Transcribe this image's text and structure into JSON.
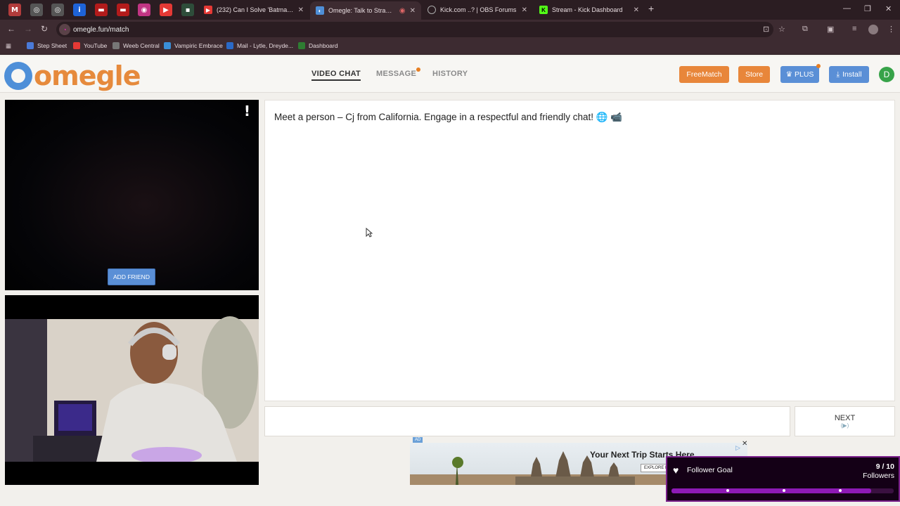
{
  "browser": {
    "tabs": [
      {
        "title": "(232) Can I Solve 'Batman The L",
        "color": "#e53935",
        "icon": "youtube-icon"
      },
      {
        "title": "Omegle: Talk to Strangers w",
        "color": "#4e8fd8",
        "icon": "omegle-icon",
        "active": true
      },
      {
        "title": "Kick.com ..? | OBS Forums",
        "color": "#888888",
        "icon": "obs-icon"
      },
      {
        "title": "Stream - Kick Dashboard",
        "color": "#53fc18",
        "icon": "kick-icon"
      }
    ],
    "url": "omegle.fun/match",
    "bookmarks": [
      {
        "label": "Step Sheet",
        "color": "#4a7ad8"
      },
      {
        "label": "YouTube",
        "color": "#e53935"
      },
      {
        "label": "Weeb Central",
        "color": "#777777"
      },
      {
        "label": "Vampiric Embrace",
        "color": "#3a8fd8"
      },
      {
        "label": "Mail - Lytle, Dreyde...",
        "color": "#2a6ac8"
      },
      {
        "label": "Dashboard",
        "color": "#2e7d32"
      }
    ]
  },
  "site": {
    "logo_text": "omegle",
    "nav": {
      "video_chat": "VIDEO CHAT",
      "message": "MESSAGE",
      "history": "HISTORY"
    },
    "buttons": {
      "freematch": "FreeMatch",
      "store": "Store",
      "plus": "PLUS",
      "install": "Install"
    },
    "avatar_letter": "D"
  },
  "video": {
    "add_friend": "ADD FRIEND",
    "report_mark": "!"
  },
  "chat": {
    "message": "Meet a person – Cj from California. Engage in a respectful and friendly chat! 🌐 📹",
    "next_label": "NEXT"
  },
  "ad": {
    "tag": "AD",
    "title": "Your Next Trip Starts Here",
    "cta": "EXPLORE NOW"
  },
  "follower_goal": {
    "label": "Follower Goal",
    "current": 9,
    "target": 10,
    "count_text": "9 / 10",
    "unit": "Followers",
    "progress_fraction": 0.9
  },
  "colors": {
    "freematch": "#e8863a",
    "store": "#e8863a",
    "plus": "#5a8fd6",
    "install": "#5a8fd6",
    "accent": "#e68a3c"
  }
}
